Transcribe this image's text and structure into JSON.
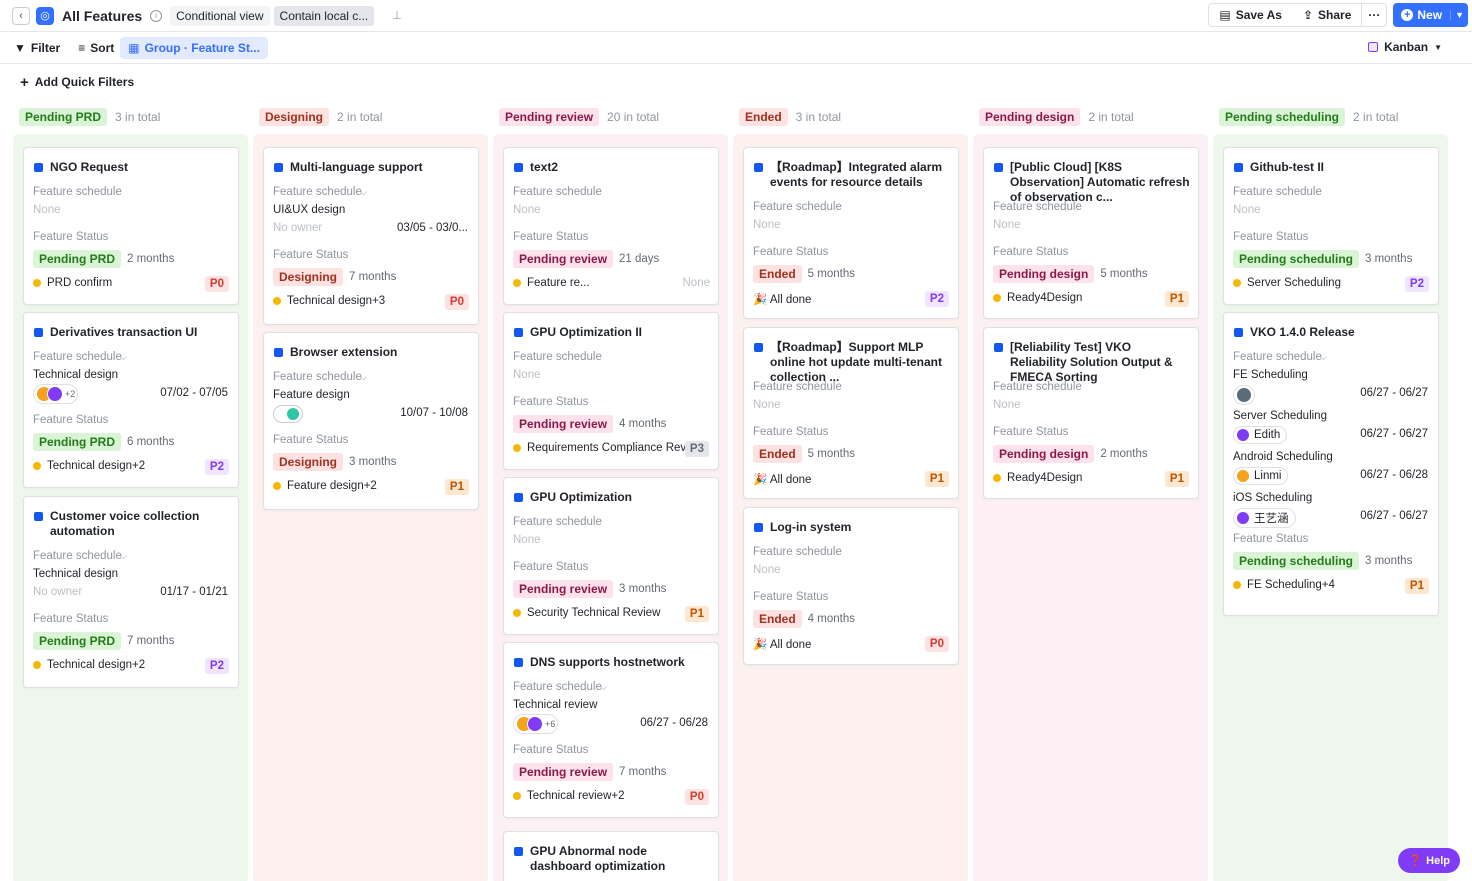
{
  "header": {
    "title": "All Features",
    "tags": [
      "Conditional view",
      "Contain local c..."
    ],
    "save_as": "Save As",
    "share": "Share",
    "new": "New"
  },
  "toolbar": {
    "filter": "Filter",
    "sort": "Sort",
    "group": "Group · Feature St...",
    "view": "Kanban"
  },
  "quick_filters": "Add Quick Filters",
  "labels": {
    "schedule": "Feature schedule",
    "status": "Feature Status",
    "none": "None",
    "no_owner": "No owner"
  },
  "columns": [
    {
      "name": "Pending PRD",
      "count": "3 in total",
      "color": "#d9f5d6",
      "text": "#237b19",
      "bg": "#eef7ec"
    },
    {
      "name": "Designing",
      "count": "2 in total",
      "color": "#fde2e2",
      "text": "#a1301f",
      "bg": "#fdf1ef"
    },
    {
      "name": "Pending review",
      "count": "20 in total",
      "color": "#fde2ec",
      "text": "#8a1948",
      "bg": "#fdf0f4"
    },
    {
      "name": "Ended",
      "count": "3 in total",
      "color": "#fde2e2",
      "text": "#a1301f",
      "bg": "#fdf1ef"
    },
    {
      "name": "Pending design",
      "count": "2 in total",
      "color": "#fde2ec",
      "text": "#8a1948",
      "bg": "#fdf0f4"
    },
    {
      "name": "Pending scheduling",
      "count": "2 in total",
      "color": "#d9f5d6",
      "text": "#237b19",
      "bg": "#eef7ec"
    }
  ],
  "cards": {
    "c1": {
      "title": "NGO Request",
      "status": "Pending PRD",
      "dur": "2 months",
      "foot": "PRD confirm",
      "pri": "P0"
    },
    "c2": {
      "title": "Derivatives transaction UI",
      "sub": "Technical design",
      "more": "+2",
      "date": "07/02 - 07/05",
      "status": "Pending PRD",
      "dur": "6 months",
      "foot": "Technical design+2",
      "pri": "P2"
    },
    "c3": {
      "title": "Customer voice collection automation",
      "sub": "Technical design",
      "date": "01/17 - 01/21",
      "status": "Pending PRD",
      "dur": "7 months",
      "foot": "Technical design+2",
      "pri": "P2"
    },
    "d1": {
      "title": "Multi-language support",
      "sub": "UI&UX design",
      "date": "03/05 - 03/0...",
      "status": "Designing",
      "dur": "7 months",
      "foot": "Technical design+3",
      "pri": "P0"
    },
    "d2": {
      "title": "Browser extension",
      "sub": "Feature design",
      "date": "10/07 - 10/08",
      "status": "Designing",
      "dur": "3 months",
      "foot": "Feature design+2",
      "pri": "P1"
    },
    "r1": {
      "title": "text2",
      "status": "Pending review",
      "dur": "21 days",
      "foot": "Feature re...",
      "foot2": "None"
    },
    "r2": {
      "title": "GPU Optimization II",
      "status": "Pending review",
      "dur": "4 months",
      "foot": "Requirements Compliance Review",
      "pri": "P3"
    },
    "r3": {
      "title": "GPU Optimization",
      "status": "Pending review",
      "dur": "3 months",
      "foot": "Security Technical Review",
      "pri": "P1"
    },
    "r4": {
      "title": "DNS supports hostnetwork",
      "sub": "Technical review",
      "more": "+6",
      "date": "06/27 - 06/28",
      "status": "Pending review",
      "dur": "7 months",
      "foot": "Technical review+2",
      "pri": "P0"
    },
    "r5": {
      "title": "GPU Abnormal node dashboard optimization"
    },
    "e1": {
      "title": "【Roadmap】Integrated alarm events for resource details",
      "status": "Ended",
      "dur": "5 months",
      "foot": "🎉 All done",
      "pri": "P2"
    },
    "e2": {
      "title": "【Roadmap】Support MLP online hot update multi-tenant collection ...",
      "status": "Ended",
      "dur": "5 months",
      "foot": "🎉 All done",
      "pri": "P1"
    },
    "e3": {
      "title": "Log-in system",
      "status": "Ended",
      "dur": "4 months",
      "foot": "🎉 All done",
      "pri": "P0"
    },
    "g1": {
      "title": "[Public Cloud] [K8S Observation] Automatic refresh of observation c...",
      "status": "Pending design",
      "dur": "5 months",
      "foot": "Ready4Design",
      "pri": "P1"
    },
    "g2": {
      "title": "[Reliability Test] VKO Reliability Solution Output & FMECA Sorting",
      "status": "Pending design",
      "dur": "2 months",
      "foot": "Ready4Design",
      "pri": "P1"
    },
    "s1": {
      "title": "Github-test II",
      "status": "Pending scheduling",
      "dur": "3 months",
      "foot": "Server Scheduling",
      "pri": "P2"
    },
    "s2": {
      "title": "VKO 1.4.0 Release",
      "status": "Pending scheduling",
      "dur": "3 months",
      "foot": "FE Scheduling+4",
      "pri": "P1",
      "rows": [
        {
          "name": "FE Scheduling",
          "person": "",
          "date": "06/27 - 06/27"
        },
        {
          "name": "Server Scheduling",
          "person": "Edith",
          "date": "06/27 - 06/27"
        },
        {
          "name": "Android Scheduling",
          "person": "Linmi",
          "date": "06/27 - 06/28"
        },
        {
          "name": "iOS Scheduling",
          "person": "王艺涵",
          "date": "06/27 - 06/27"
        }
      ]
    }
  },
  "help": "Help"
}
